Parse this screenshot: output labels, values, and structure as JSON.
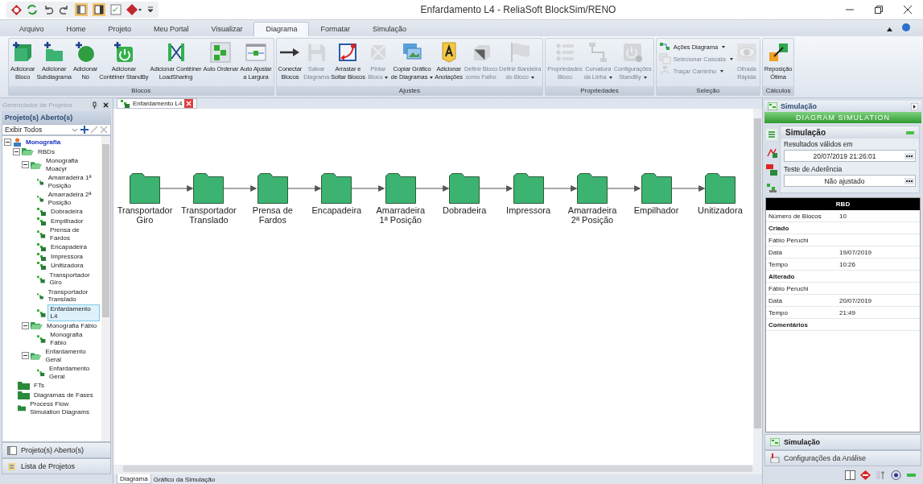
{
  "window": {
    "title": "Enfardamento L4 - ReliaSoft BlockSim/RENO"
  },
  "menu_tabs": [
    {
      "label": "Arquivo",
      "selected": false
    },
    {
      "label": "Home",
      "selected": false
    },
    {
      "label": "Projeto",
      "selected": false
    },
    {
      "label": "Meu Portal",
      "selected": false
    },
    {
      "label": "Visualizar",
      "selected": false
    },
    {
      "label": "Diagrama",
      "selected": true
    },
    {
      "label": "Formatar",
      "selected": false
    },
    {
      "label": "Simulação",
      "selected": false
    }
  ],
  "ribbon": [
    {
      "label": "Blocos",
      "buttons": [
        {
          "kind": "large",
          "lines": [
            "Adicionar",
            "Bloco"
          ],
          "disabled": false,
          "dropdown": false
        },
        {
          "kind": "large",
          "lines": [
            "Adicionar",
            "Subdiagrama"
          ],
          "disabled": false,
          "dropdown": false
        },
        {
          "kind": "large",
          "lines": [
            "Adicionar",
            "Nó"
          ],
          "disabled": false,
          "dropdown": false
        },
        {
          "kind": "large",
          "lines": [
            "Adicionar",
            "Contêiner StandBy"
          ],
          "disabled": false,
          "dropdown": false
        },
        {
          "kind": "large",
          "lines": [
            "Adicionar Contêiner",
            "LoadSharing"
          ],
          "disabled": false,
          "dropdown": false
        },
        {
          "kind": "large",
          "lines": [
            "Auto Ordenar"
          ],
          "disabled": false,
          "dropdown": false
        },
        {
          "kind": "large",
          "lines": [
            "Auto Ajustar",
            "a Largura"
          ],
          "disabled": false,
          "dropdown": false
        }
      ]
    },
    {
      "label": "Ajustes",
      "buttons": [
        {
          "kind": "large",
          "lines": [
            "Conectar",
            "Blocos"
          ],
          "disabled": false,
          "dropdown": false
        },
        {
          "kind": "large",
          "lines": [
            "Salvar",
            "Diagrama"
          ],
          "disabled": true,
          "dropdown": false
        },
        {
          "kind": "large",
          "lines": [
            "Arrastar e",
            "Soltar Blocos"
          ],
          "disabled": false,
          "dropdown": false
        },
        {
          "kind": "large",
          "lines": [
            "Pintar",
            "Bloco"
          ],
          "disabled": true,
          "dropdown": true
        },
        {
          "kind": "large",
          "lines": [
            "Copiar Gráfico",
            "de Diagramas"
          ],
          "disabled": false,
          "dropdown": true
        },
        {
          "kind": "large",
          "lines": [
            "Adicionar",
            "Anotações"
          ],
          "disabled": false,
          "dropdown": false
        },
        {
          "kind": "large",
          "lines": [
            "Definir Bloco",
            "como Falho"
          ],
          "disabled": true,
          "dropdown": false
        },
        {
          "kind": "large",
          "lines": [
            "Definir Bandeira",
            "do Bloco"
          ],
          "disabled": true,
          "dropdown": true
        }
      ]
    },
    {
      "label": "Propriedades",
      "buttons": [
        {
          "kind": "large",
          "lines": [
            "Propriedades",
            "Bloco"
          ],
          "disabled": true,
          "dropdown": false
        },
        {
          "kind": "large",
          "lines": [
            "Curvatura",
            "da Linha"
          ],
          "disabled": true,
          "dropdown": true
        },
        {
          "kind": "large",
          "lines": [
            "Configurações",
            "StandBy"
          ],
          "disabled": true,
          "dropdown": true
        }
      ]
    },
    {
      "label": "Seleção",
      "buttons": [
        {
          "kind": "small",
          "lines": [
            "Ações Diagrama"
          ],
          "disabled": false,
          "dropdown": true
        },
        {
          "kind": "small",
          "lines": [
            "Selecionar Cascata"
          ],
          "disabled": true,
          "dropdown": true
        },
        {
          "kind": "small",
          "lines": [
            "Traçar Caminho"
          ],
          "disabled": true,
          "dropdown": true
        },
        {
          "kind": "large",
          "lines": [
            "Olhada",
            "Rápida"
          ],
          "disabled": true,
          "dropdown": false
        }
      ]
    },
    {
      "label": "Cálculos",
      "buttons": [
        {
          "kind": "large",
          "lines": [
            "Reposição",
            "Ótima"
          ],
          "disabled": false,
          "dropdown": false
        }
      ]
    }
  ],
  "left_panel": {
    "title": "Gerenciador de Projetos",
    "section": "Projeto(s) Aberto(s)",
    "filter": "Exibir Todos",
    "tree": [
      {
        "label": "Monografia",
        "kind": "project",
        "expanded": true,
        "selected": false,
        "children": [
          {
            "label": "RBDs",
            "kind": "folder",
            "expanded": true,
            "selected": false,
            "children": [
              {
                "label": "Monografia Moacyr",
                "kind": "folder",
                "expanded": true,
                "selected": false,
                "children": [
                  {
                    "label": "Amarradeira 1ª Posição",
                    "kind": "diagram",
                    "selected": false
                  },
                  {
                    "label": "Amarradeira 2ª Posição",
                    "kind": "diagram",
                    "selected": false
                  },
                  {
                    "label": "Dobradeira",
                    "kind": "diagram",
                    "selected": false
                  },
                  {
                    "label": "Empilhador",
                    "kind": "diagram",
                    "selected": false
                  },
                  {
                    "label": "Prensa de Fardos",
                    "kind": "diagram",
                    "selected": false
                  },
                  {
                    "label": "Encapadeira",
                    "kind": "diagram",
                    "selected": false
                  },
                  {
                    "label": "Impressora",
                    "kind": "diagram",
                    "selected": false
                  },
                  {
                    "label": "Unitizadora",
                    "kind": "diagram",
                    "selected": false
                  },
                  {
                    "label": "Transportador Giro",
                    "kind": "diagram",
                    "selected": false
                  },
                  {
                    "label": "Transportador Translado",
                    "kind": "diagram",
                    "selected": false
                  },
                  {
                    "label": "Enfardamento L4",
                    "kind": "diagram",
                    "selected": true
                  }
                ]
              },
              {
                "label": "Monografia Fábio",
                "kind": "folder",
                "expanded": true,
                "selected": false,
                "children": [
                  {
                    "label": "Monografia Fábio",
                    "kind": "diagram",
                    "selected": false
                  }
                ]
              },
              {
                "label": "Enfardamento Geral",
                "kind": "folder",
                "expanded": true,
                "selected": false,
                "children": [
                  {
                    "label": "Enfardamento Geral",
                    "kind": "diagram",
                    "selected": false
                  }
                ]
              }
            ]
          },
          {
            "label": "FTs",
            "kind": "bigfolder",
            "selected": false
          },
          {
            "label": "Diagramas de Fases",
            "kind": "bigfolder",
            "selected": false
          },
          {
            "label": "Process Flow Simulation Diagrams",
            "kind": "bigfolder",
            "selected": false
          }
        ]
      }
    ],
    "panes": [
      "Projeto(s) Aberto(s)",
      "Lista de Projetos"
    ]
  },
  "document_tabs": [
    {
      "label": "Enfardamento L4",
      "selected": true
    }
  ],
  "diagram": {
    "blocks": [
      {
        "lines": [
          "Transportador",
          "Giro"
        ]
      },
      {
        "lines": [
          "Transportador",
          "Translado"
        ]
      },
      {
        "lines": [
          "Prensa de",
          "Fardos"
        ]
      },
      {
        "lines": [
          "Encapadeira"
        ]
      },
      {
        "lines": [
          "Amarradeira",
          "1ª Posição"
        ]
      },
      {
        "lines": [
          "Dobradeira"
        ]
      },
      {
        "lines": [
          "Impressora"
        ]
      },
      {
        "lines": [
          "Amarradeira",
          "2ª Posição"
        ]
      },
      {
        "lines": [
          "Empilhador"
        ]
      },
      {
        "lines": [
          "Unitizadora"
        ]
      }
    ]
  },
  "view_tabs": [
    {
      "label": "Diagrama",
      "selected": true
    },
    {
      "label": "Gráfico da Simulação",
      "selected": false
    }
  ],
  "right_panel": {
    "title": "Simulação",
    "banner": "DIAGRAM SIMULATION",
    "simulation": {
      "title": "Simulação",
      "fields": [
        {
          "label": "Resultados válidos em",
          "value": "20/07/2019 21:26:01"
        },
        {
          "label": "Teste de Aderência",
          "value": "Não ajustado"
        }
      ]
    },
    "properties": {
      "header": "RBD",
      "rows": [
        {
          "kind": "pair",
          "label": "Número de Blocos",
          "value": "10"
        },
        {
          "kind": "section",
          "label": "Criado"
        },
        {
          "kind": "single",
          "label": "Fábio  Peruchi"
        },
        {
          "kind": "pair",
          "label": "Data",
          "value": "19/07/2019"
        },
        {
          "kind": "pair",
          "label": "Tempo",
          "value": "10:26"
        },
        {
          "kind": "section",
          "label": "Alterado"
        },
        {
          "kind": "single",
          "label": "Fábio  Peruchi"
        },
        {
          "kind": "pair",
          "label": "Data",
          "value": "20/07/2019"
        },
        {
          "kind": "pair",
          "label": "Tempo",
          "value": "21:49"
        },
        {
          "kind": "section",
          "label": "Comentários"
        }
      ]
    },
    "panes": [
      {
        "label": "Simulação",
        "selected": true
      },
      {
        "label": "Configurações da Análise",
        "selected": false
      }
    ]
  }
}
